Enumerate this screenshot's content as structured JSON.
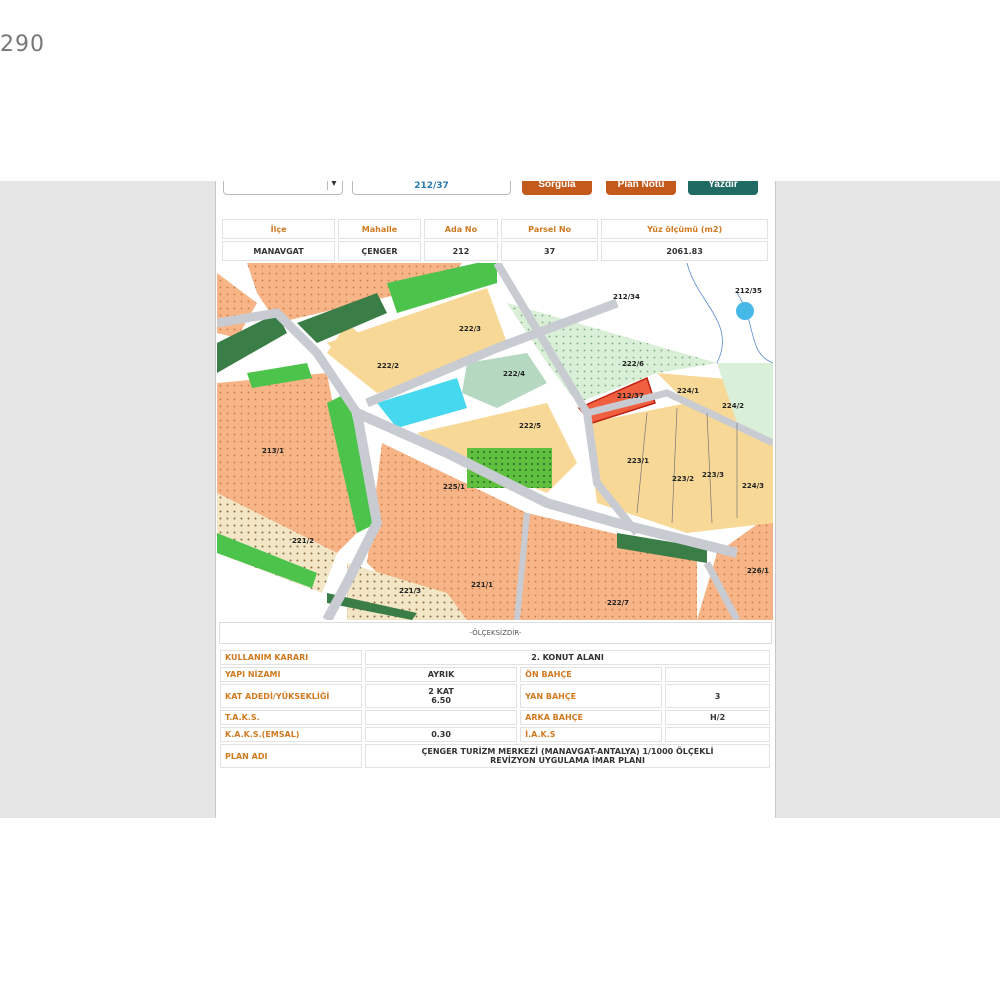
{
  "corner_text": "290",
  "toolbar": {
    "select_value": "",
    "parcel_input": "212/37",
    "sorgula_label": "Sorgula",
    "plan_notu_label": "Plan Notu",
    "yazdir_label": "Yazdır"
  },
  "info_table": {
    "headers": [
      "İlçe",
      "Mahalle",
      "Ada No",
      "Parsel No",
      "Yüz ölçümü (m2)"
    ],
    "values": [
      "MANAVGAT",
      "ÇENGER",
      "212",
      "37",
      "2061.83"
    ]
  },
  "map": {
    "labels": [
      "212/34",
      "212/35",
      "222/3",
      "222/2",
      "222/4",
      "212/37",
      "222/5",
      "222/6",
      "223/1",
      "223/2",
      "223/3",
      "224/1",
      "224/2",
      "224/3",
      "213/1",
      "225/1",
      "221/1",
      "221/2",
      "221/3",
      "222/7",
      "226/1"
    ],
    "colors": {
      "residential": "#f7d896",
      "tourism": "#f6b487",
      "green": "#4cc44c",
      "dark_green": "#3a7d47",
      "sport": "#5fbf3f",
      "light_green": "#d9efd7",
      "water": "#46d8ee",
      "selected_parcel": "#f06040",
      "road": "#c8ccd2"
    }
  },
  "scale_label": "-ÖLÇEKSİZDİR-",
  "details": {
    "kullanim_karari_label": "KULLANIM KARARI",
    "kullanim_karari_value": "2. KONUT ALANI",
    "yapi_nizami_label": "YAPI NİZAMI",
    "yapi_nizami_value": "AYRIK",
    "on_bahce_label": "ÖN BAHÇE",
    "on_bahce_value": "",
    "kat_adedi_label": "KAT ADEDİ/YÜKSEKLİĞİ",
    "kat_adedi_value_1": "2 KAT",
    "kat_adedi_value_2": "6.50",
    "yan_bahce_label": "YAN BAHÇE",
    "yan_bahce_value": "3",
    "taks_label": "T.A.K.S.",
    "taks_value": "",
    "arka_bahce_label": "ARKA BAHÇE",
    "arka_bahce_value": "H/2",
    "kaks_label": "K.A.K.S.(EMSAL)",
    "kaks_value": "0.30",
    "iaks_label": "İ.A.K.S",
    "iaks_value": "",
    "plan_adi_label": "PLAN ADI",
    "plan_adi_value_1": "ÇENGER TURİZM MERKEZİ (MANAVGAT-ANTALYA) 1/1000 ÖLÇEKLİ",
    "plan_adi_value_2": "REVİZYON UYGULAMA İMAR PLANI"
  }
}
